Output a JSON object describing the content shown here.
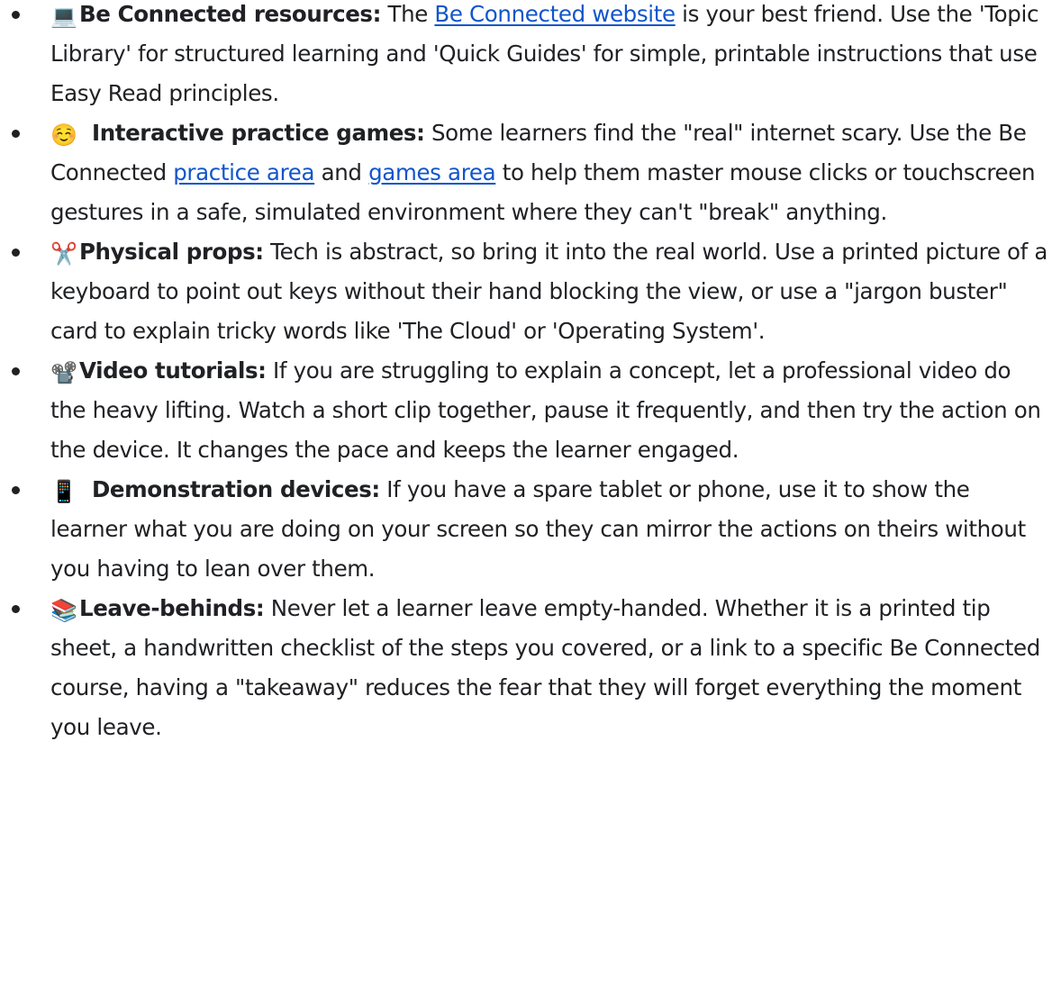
{
  "items": [
    {
      "icon": "💻",
      "icon_name": "laptop-icon",
      "label": "Be Connected resources:",
      "text_1": " The ",
      "link_1": "Be Connected website",
      "text_2": " is your best friend. Use the 'Topic Library' for structured learning and 'Quick Guides' for simple, printable instructions that use Easy Read principles."
    },
    {
      "icon": "☺️",
      "icon_name": "smiling-face-icon",
      "label": "Interactive practice games:",
      "text_1": " Some learners find the \"real\" internet scary. Use the Be Connected ",
      "link_1": "practice area",
      "text_2": " and ",
      "link_2": "games area",
      "text_3": " to help them master mouse clicks or touchscreen gestures in a safe, simulated environment where they can't \"break\" anything."
    },
    {
      "icon": "✂️",
      "icon_name": "scissors-icon",
      "label": "Physical props:",
      "text_1": " Tech is abstract, so bring it into the real world. Use a printed picture of a keyboard to point out keys without their hand blocking the view, or use a \"jargon buster\" card to explain tricky words like 'The Cloud' or 'Operating System'."
    },
    {
      "icon": "📽️",
      "icon_name": "film-projector-icon",
      "label": "Video tutorials:",
      "text_1": " If you are struggling to explain a concept, let a professional video do the heavy lifting. Watch a short clip together, pause it frequently, and then try the action on the device. It changes the pace and keeps the learner engaged."
    },
    {
      "icon": "📱",
      "icon_name": "mobile-phone-icon",
      "label": "Demonstration devices:",
      "text_1": " If you have a spare tablet or phone, use it to show the learner what you are doing on your screen so they can mirror the actions on theirs without you having to lean over them."
    },
    {
      "icon": "📚",
      "icon_name": "books-icon",
      "label": "Leave-behinds:",
      "text_1": " Never let a learner leave empty-handed. Whether it is a printed tip sheet, a handwritten checklist of the steps you covered, or a link to a specific Be Connected course, having a \"takeaway\" reduces the fear that they will forget everything the moment you leave."
    }
  ],
  "colors": {
    "text": "#202124",
    "link": "#1155cc"
  }
}
